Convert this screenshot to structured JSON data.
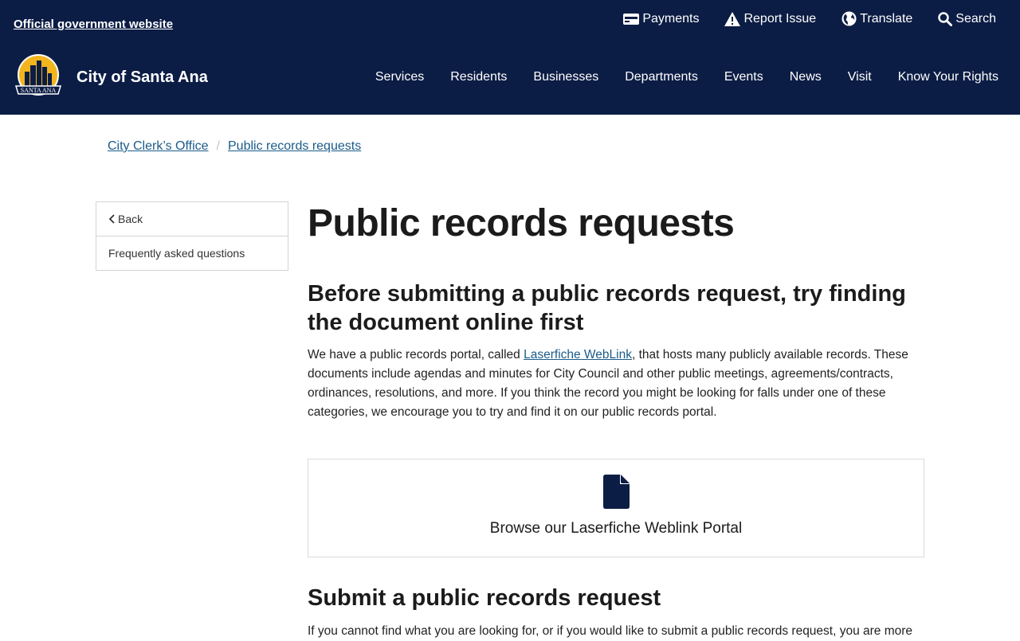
{
  "header": {
    "official_label": "Official government website",
    "utility": [
      {
        "label": "Payments",
        "icon": "credit-card-icon"
      },
      {
        "label": "Report Issue",
        "icon": "warning-icon"
      },
      {
        "label": "Translate",
        "icon": "globe-icon"
      },
      {
        "label": "Search",
        "icon": "search-icon"
      }
    ],
    "city_name": "City of Santa Ana",
    "logo_text": "SANTA ANA",
    "nav": [
      "Services",
      "Residents",
      "Businesses",
      "Departments",
      "Events",
      "News",
      "Visit",
      "Know Your Rights"
    ]
  },
  "breadcrumb": [
    "City Clerk’s Office",
    "Public records requests"
  ],
  "sidebar": {
    "back_label": "Back",
    "items": [
      "Frequently asked questions"
    ]
  },
  "main": {
    "title": "Public records requests",
    "section1_heading": "Before submitting a public records request, try finding the document online first",
    "section1_text_before": "We have a public records portal, called ",
    "section1_link": "Laserfiche WebLink",
    "section1_text_after": ", that hosts many publicly available records. These documents include agendas and minutes for City Council and other public meetings, agreements/contracts, ordinances, resolutions, and more. If you think the record you might be looking for falls under one of these categories, we encourage you to try and find it on our public records portal.",
    "card_label": "Browse our Laserfiche Weblink Portal",
    "card_icon": "document-icon",
    "section2_heading": "Submit a public records request",
    "section2_text": "If you cannot find what you are looking for, or if you would like to submit a public records request, you are more"
  },
  "colors": {
    "header_bg": "#0c1d45",
    "link": "#1a5b8a",
    "logo_gold": "#f2b51e"
  }
}
